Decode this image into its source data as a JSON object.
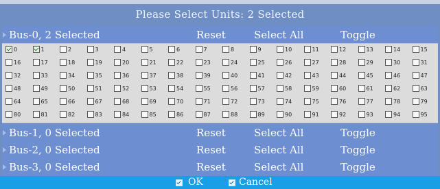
{
  "dialog": {
    "title": "Please Select Units: 2 Selected"
  },
  "buses": [
    {
      "name": "Bus-0, 2 Selected",
      "reset": "Reset",
      "select_all": "Select All",
      "toggle": "Toggle"
    },
    {
      "name": "Bus-1, 0 Selected",
      "reset": "Reset",
      "select_all": "Select All",
      "toggle": "Toggle"
    },
    {
      "name": "Bus-2, 0 Selected",
      "reset": "Reset",
      "select_all": "Select All",
      "toggle": "Toggle"
    },
    {
      "name": "Bus-3, 0 Selected",
      "reset": "Reset",
      "select_all": "Select All",
      "toggle": "Toggle"
    }
  ],
  "units": {
    "labels": [
      "0",
      "1",
      "2",
      "3",
      "4",
      "5",
      "6",
      "7",
      "8",
      "9",
      "10",
      "11",
      "12",
      "13",
      "14",
      "15",
      "16",
      "17",
      "18",
      "19",
      "20",
      "21",
      "22",
      "23",
      "24",
      "25",
      "26",
      "27",
      "28",
      "29",
      "30",
      "31",
      "32",
      "33",
      "34",
      "35",
      "36",
      "37",
      "38",
      "39",
      "40",
      "41",
      "42",
      "43",
      "44",
      "45",
      "46",
      "47",
      "48",
      "49",
      "50",
      "51",
      "52",
      "53",
      "54",
      "55",
      "56",
      "57",
      "58",
      "59",
      "60",
      "61",
      "62",
      "63",
      "64",
      "65",
      "66",
      "67",
      "68",
      "69",
      "70",
      "71",
      "72",
      "73",
      "74",
      "75",
      "76",
      "77",
      "78",
      "79",
      "80",
      "81",
      "82",
      "83",
      "84",
      "85",
      "86",
      "87",
      "88",
      "89",
      "90",
      "91",
      "92",
      "93",
      "94",
      "95"
    ],
    "checked": [
      "0",
      "1"
    ]
  },
  "footer": {
    "ok": "OK",
    "cancel": "Cancel"
  }
}
